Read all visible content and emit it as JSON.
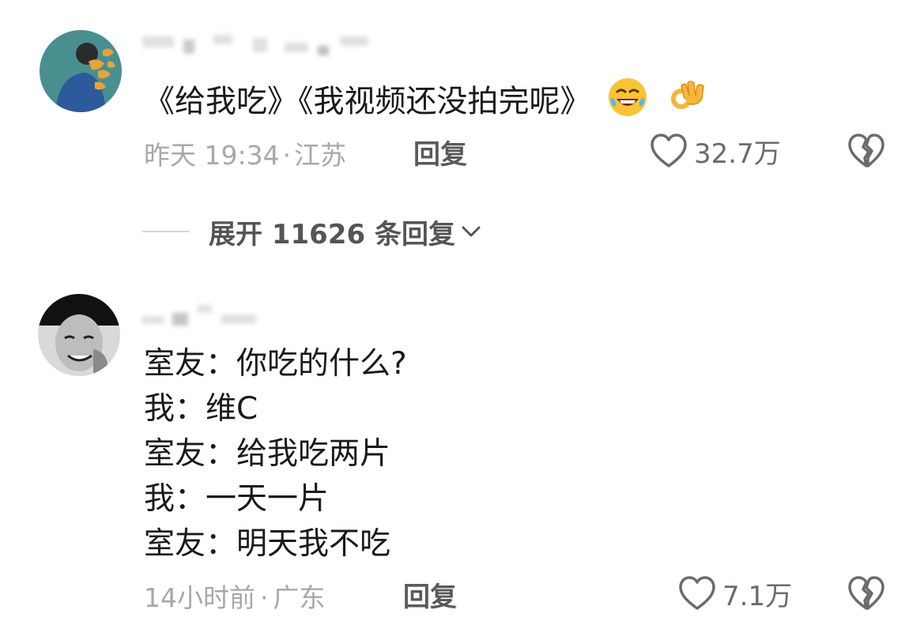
{
  "comments": [
    {
      "text_lines": [
        "《给我吃》《我视频还没拍完呢》"
      ],
      "emojis": [
        "rolling-laughing-emoji",
        "ok-hand-emoji"
      ],
      "time": "昨天 19:34",
      "location": "江苏",
      "reply_label": "回复",
      "likes": "32.7万"
    },
    {
      "text_lines": [
        "室友：你吃的什么?",
        "我：维C",
        "室友：给我吃两片",
        "我：一天一片",
        "室友：明天我不吃"
      ],
      "time": "14小时前",
      "location": "广东",
      "reply_label": "回复",
      "likes": "7.1万"
    }
  ],
  "expand_replies": {
    "label": "展开 11626 条回复"
  },
  "colors": {
    "text": "#1a1a1a",
    "meta": "#a8a8a8",
    "icon": "#6b6b6b"
  },
  "meta_separator": "·"
}
